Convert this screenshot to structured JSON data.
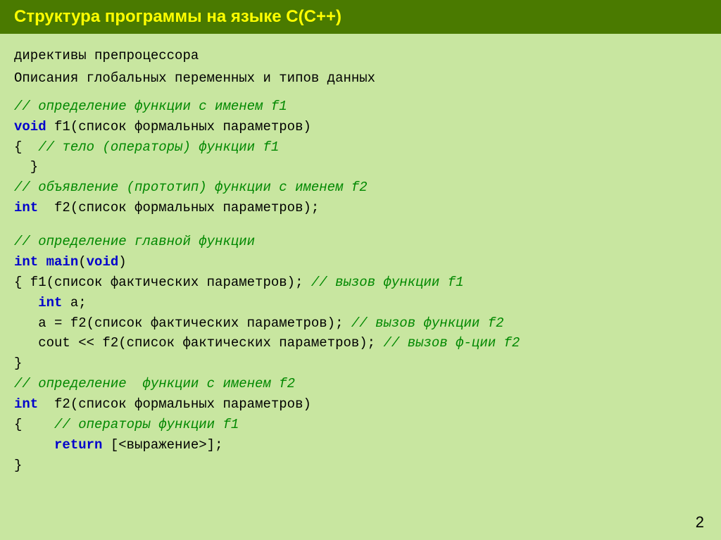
{
  "header": {
    "title": "Структура программы на языке С(С++)"
  },
  "intro": {
    "line1": "директивы препроцессора",
    "line2": "Описания глобальных переменных и типов данных"
  },
  "code": [
    {
      "type": "comment",
      "text": "// определение функции с именем f1"
    },
    {
      "type": "mixed",
      "parts": [
        {
          "kind": "keyword",
          "text": "void"
        },
        {
          "kind": "normal",
          "text": " f1(список формальных параметров)"
        }
      ]
    },
    {
      "type": "mixed",
      "parts": [
        {
          "kind": "normal",
          "text": "{  "
        },
        {
          "kind": "comment",
          "text": "// тело (операторы) функции f1"
        }
      ]
    },
    {
      "type": "normal",
      "text": "  }"
    },
    {
      "type": "comment",
      "text": "// объявление (прототип) функции с именем f2"
    },
    {
      "type": "mixed",
      "parts": [
        {
          "kind": "keyword",
          "text": "int"
        },
        {
          "kind": "normal",
          "text": "  f2(список формальных параметров);"
        }
      ]
    },
    {
      "type": "blank"
    },
    {
      "type": "comment",
      "text": "// определение главной функции"
    },
    {
      "type": "mixed",
      "parts": [
        {
          "kind": "keyword",
          "text": "int"
        },
        {
          "kind": "normal",
          "text": " "
        },
        {
          "kind": "keyword",
          "text": "main"
        },
        {
          "kind": "normal",
          "text": "("
        },
        {
          "kind": "keyword",
          "text": "void"
        },
        {
          "kind": "normal",
          "text": ")"
        }
      ]
    },
    {
      "type": "mixed",
      "parts": [
        {
          "kind": "normal",
          "text": "{ f1(список фактических параметров); "
        },
        {
          "kind": "comment",
          "text": "// вызов функции f1"
        }
      ]
    },
    {
      "type": "mixed",
      "parts": [
        {
          "kind": "normal",
          "text": "   "
        },
        {
          "kind": "keyword",
          "text": "int"
        },
        {
          "kind": "normal",
          "text": " a;"
        }
      ]
    },
    {
      "type": "mixed",
      "parts": [
        {
          "kind": "normal",
          "text": "   a = f2(список фактических параметров); "
        },
        {
          "kind": "comment",
          "text": "// вызов функции f2"
        }
      ]
    },
    {
      "type": "mixed",
      "parts": [
        {
          "kind": "normal",
          "text": "   cout << f2(список фактических параметров); "
        },
        {
          "kind": "comment",
          "text": "// вызов ф-ции f2"
        }
      ]
    },
    {
      "type": "normal",
      "text": "}"
    },
    {
      "type": "comment",
      "text": "// определение  функции с именем f2"
    },
    {
      "type": "mixed",
      "parts": [
        {
          "kind": "keyword",
          "text": "int"
        },
        {
          "kind": "normal",
          "text": "  f2(список формальных параметров)"
        }
      ]
    },
    {
      "type": "mixed",
      "parts": [
        {
          "kind": "normal",
          "text": "{    "
        },
        {
          "kind": "comment",
          "text": "// операторы функции f1"
        }
      ]
    },
    {
      "type": "mixed",
      "parts": [
        {
          "kind": "normal",
          "text": "     "
        },
        {
          "kind": "keyword",
          "text": "return"
        },
        {
          "kind": "normal",
          "text": " [<выражение>];"
        }
      ]
    },
    {
      "type": "normal",
      "text": "}"
    }
  ],
  "page_number": "2"
}
